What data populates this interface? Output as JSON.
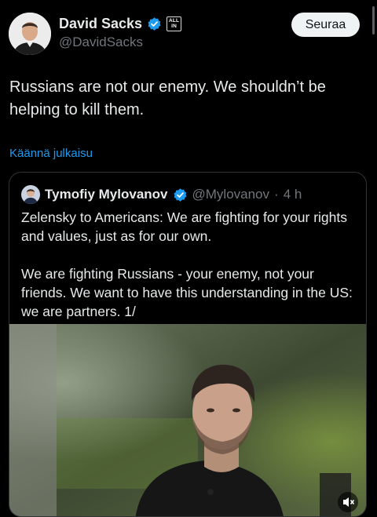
{
  "author": {
    "display_name": "David Sacks",
    "handle": "@DavidSacks",
    "badge_text_line1": "ALL",
    "badge_text_line2": "IN",
    "avatar": "avatar-photo"
  },
  "follow_button": {
    "label": "Seuraa"
  },
  "tweet": {
    "text": "Russians are not our enemy. We shouldn’t be helping to kill them.",
    "translate_label": "Käännä julkaisu"
  },
  "quoted_tweet": {
    "display_name": "Tymofiy Mylovanov",
    "handle": "@Mylovanov",
    "separator": "·",
    "time": "4 h",
    "paragraphs": [
      "Zelensky to Americans: We are fighting for your rights and values, just as for our own.",
      "We are fighting Russians - your enemy, not your friends. We want to have this understanding in the US: we are partners. 1/"
    ],
    "media": {
      "type": "video",
      "time_badge": "",
      "icon": "volume-off-icon"
    }
  },
  "colors": {
    "background": "#000000",
    "text": "#e7e9ea",
    "secondary_text": "#71767b",
    "link": "#1d9bf0",
    "verified": "#1d9bf0",
    "border": "#2f3336"
  }
}
